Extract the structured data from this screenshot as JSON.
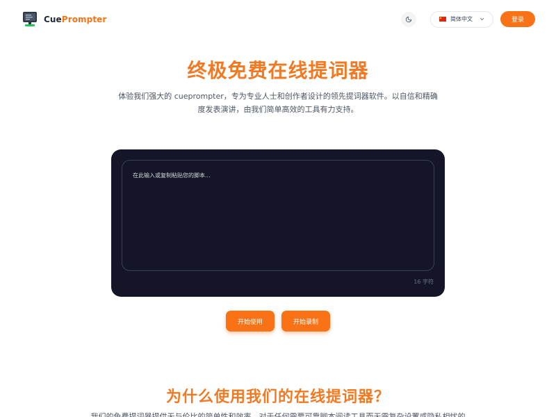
{
  "header": {
    "brand_cue": "Cue",
    "brand_prompter": "Prompter",
    "language_label": "简体中文",
    "login_label": "登录"
  },
  "hero": {
    "title": "终极免费在线提词器",
    "description_line1": "体验我们强大的 cueprompter，专为专业人士和创作者设计的领先提词器软件。以自信和精确",
    "description_line2": "度发表演讲，由我们简单高效的工具有力支持。"
  },
  "editor": {
    "placeholder": "在此输入或复制粘贴您的脚本...",
    "char_count": "16 字符"
  },
  "actions": {
    "start_label": "开始使用",
    "record_label": "开始录制"
  },
  "why": {
    "title": "为什么使用我们的在线提词器？",
    "description": "我们的免费提词器提供无与伦比的简单性和效率，对于任何需要可靠脚本阅读工具而无需复杂设置或隐私相忧的"
  },
  "colors": {
    "accent": "#f97316",
    "editor_bg": "#141627"
  },
  "icons": {
    "logo": "monitor-logo-icon",
    "theme": "moon-icon",
    "flag": "china-flag-icon",
    "dropdown": "chevron-down-icon"
  }
}
